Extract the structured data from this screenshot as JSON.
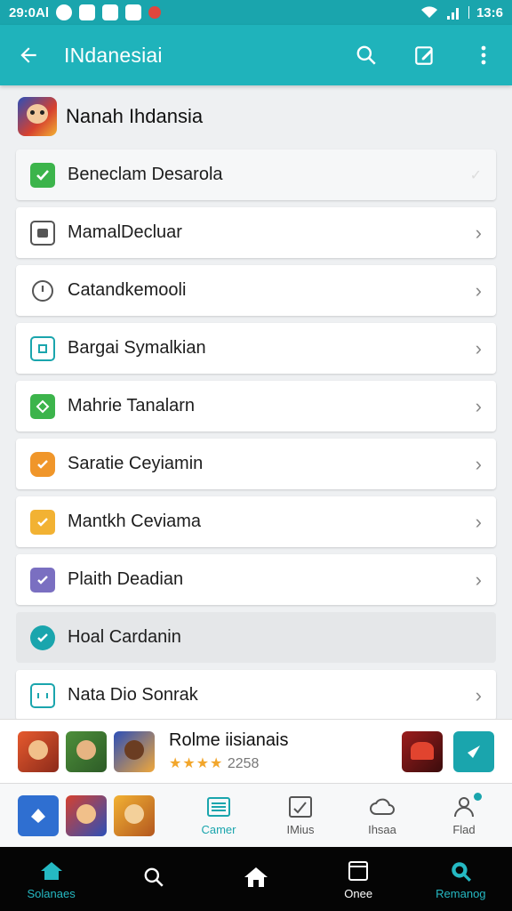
{
  "status_bar": {
    "time": "29:0Al",
    "clock_right": "13:6"
  },
  "app_bar": {
    "title": "INdanesiai"
  },
  "section": {
    "title": "Nanah Ihdansia"
  },
  "menu_items": [
    {
      "label": "Beneclam Desarola",
      "icon": "check-icon",
      "color": "#3cb44b"
    },
    {
      "label": "MamalDecluar",
      "icon": "image-icon",
      "color": "#555555"
    },
    {
      "label": "Catandkemooli",
      "icon": "clock-icon",
      "color": "#555555"
    },
    {
      "label": "Bargai Symalkian",
      "icon": "grid-icon",
      "color": "#1aa5ad"
    },
    {
      "label": "Mahrie Tanalarn",
      "icon": "tag-icon",
      "color": "#3cb44b"
    },
    {
      "label": "Saratie Ceyiamin",
      "icon": "badge-icon",
      "color": "#f0962a"
    },
    {
      "label": "Mantkh Ceviama",
      "icon": "badge-icon",
      "color": "#f2b233"
    },
    {
      "label": "Plaith Deadian",
      "icon": "checkbox-icon",
      "color": "#7a6fc1"
    },
    {
      "label": "Hoal Cardanin",
      "icon": "check-circle-icon",
      "color": "#1aa5ad"
    },
    {
      "label": "Nata Dio Sonrak",
      "icon": "counter-icon",
      "color": "#1aa5ad"
    }
  ],
  "promo": {
    "name": "Rolme iisianais",
    "stars": "★★★★",
    "rating": "2258"
  },
  "tabs": [
    {
      "label": "Camer",
      "icon": "keyboard-icon"
    },
    {
      "label": "IMius",
      "icon": "chart-icon"
    },
    {
      "label": "Ihsaa",
      "icon": "cloud-icon"
    },
    {
      "label": "Flad",
      "icon": "person-icon"
    }
  ],
  "bottom_nav": [
    {
      "label": "Solanaes",
      "icon": "home-icon"
    },
    {
      "label": "",
      "icon": "search-icon"
    },
    {
      "label": "",
      "icon": "house-icon"
    },
    {
      "label": "Onee",
      "icon": "window-icon"
    },
    {
      "label": "Remanog",
      "icon": "search-badge-icon"
    }
  ],
  "colors": {
    "primary": "#1fb3bb",
    "status": "#1aa5ad",
    "accent": "#25b9c3"
  }
}
